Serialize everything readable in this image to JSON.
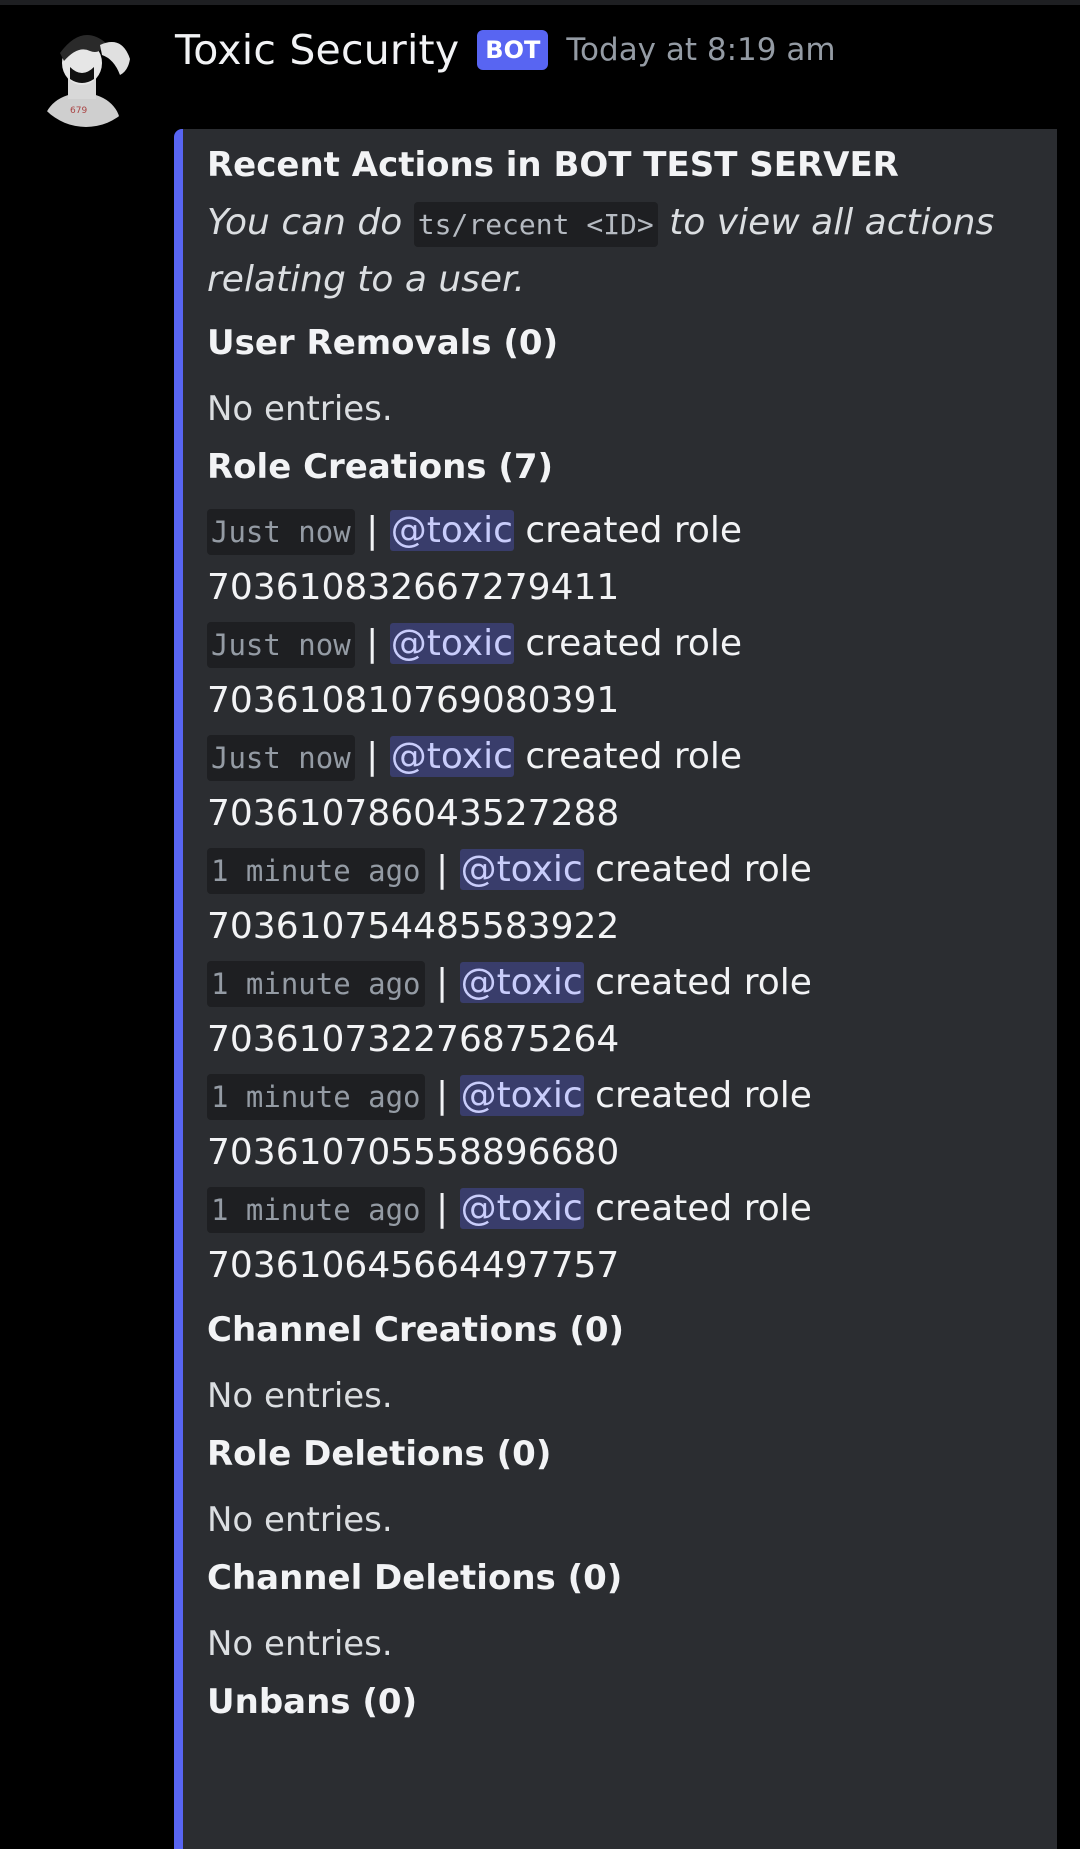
{
  "message": {
    "author": {
      "name": "Toxic Security",
      "badge": "BOT",
      "timestamp": "Today at 8:19 am"
    },
    "embed": {
      "title": "Recent Actions in BOT TEST SERVER",
      "description": {
        "before": "You can do ",
        "code": "ts/recent <ID>",
        "after": " to view all actions relating to a user."
      },
      "accent_color": "#5865f2",
      "fields": {
        "user_removals": {
          "name": "User Removals (0)",
          "value": "No entries."
        },
        "role_creations": {
          "name": "Role Creations (7)",
          "entries": [
            {
              "time": "Just now",
              "separator": "|",
              "mention": "@toxic",
              "action": "created role",
              "role_id": "703610832667279411"
            },
            {
              "time": "Just now",
              "separator": "|",
              "mention": "@toxic",
              "action": "created role",
              "role_id": "703610810769080391"
            },
            {
              "time": "Just now",
              "separator": "|",
              "mention": "@toxic",
              "action": "created role",
              "role_id": "703610786043527288"
            },
            {
              "time": "1 minute ago",
              "separator": "|",
              "mention": "@toxic",
              "action": "created role",
              "role_id": "703610754485583922"
            },
            {
              "time": "1 minute ago",
              "separator": "|",
              "mention": "@toxic",
              "action": "created role",
              "role_id": "703610732276875264"
            },
            {
              "time": "1 minute ago",
              "separator": "|",
              "mention": "@toxic",
              "action": "created role",
              "role_id": "703610705558896680"
            },
            {
              "time": "1 minute ago",
              "separator": "|",
              "mention": "@toxic",
              "action": "created role",
              "role_id": "703610645664497757"
            }
          ]
        },
        "channel_creations": {
          "name": "Channel Creations (0)",
          "value": "No entries."
        },
        "role_deletions": {
          "name": "Role Deletions (0)",
          "value": "No entries."
        },
        "channel_deletions": {
          "name": "Channel Deletions (0)",
          "value": "No entries."
        },
        "unbans": {
          "name": "Unbans (0)"
        }
      }
    }
  },
  "colors": {
    "background": "#000000",
    "embed_background": "#2b2d31",
    "mention_text": "#c9cdfb",
    "badge": "#5865f2",
    "timestamp": "#949ba4"
  }
}
